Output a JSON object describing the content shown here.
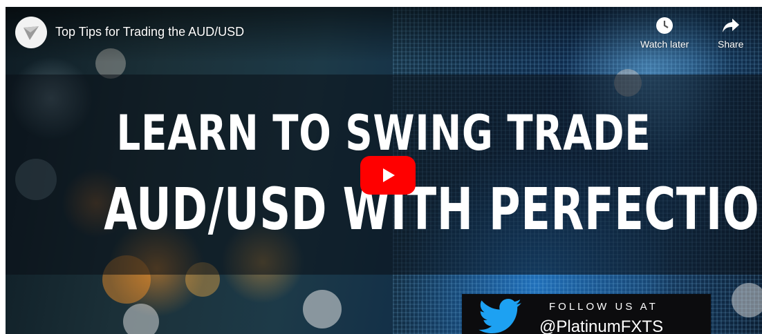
{
  "video": {
    "title": "Top Tips for Trading the AUD/USD",
    "channel_avatar_icon": "paper-plane-logo-icon"
  },
  "actions": {
    "watch_later": {
      "label": "Watch later",
      "icon": "clock-icon"
    },
    "share": {
      "label": "Share",
      "icon": "share-arrow-icon"
    }
  },
  "thumbnail": {
    "headline_line1": "LEARN TO SWING TRADE",
    "headline_line2": "AUD/USD WITH PERFECTION",
    "promo_follow": "FOLLOW US AT",
    "promo_handle": "@PlatinumFXTS",
    "promo_icon": "twitter-bird-icon"
  },
  "play_button": {
    "icon": "youtube-play-icon",
    "color": "#ff0000"
  },
  "colors": {
    "twitter": "#1da1f2",
    "text": "#ffffff"
  }
}
